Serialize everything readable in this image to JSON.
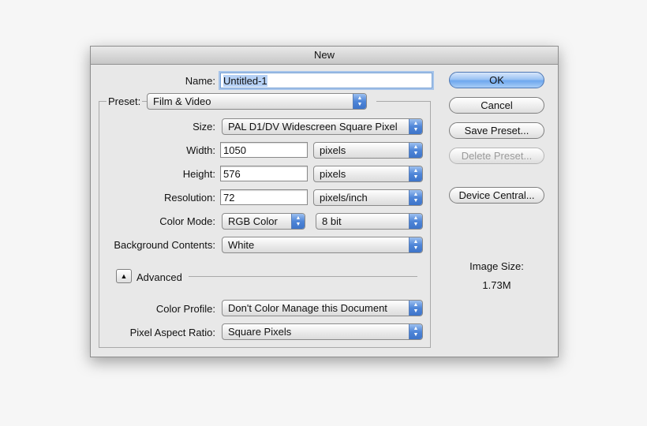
{
  "dialog": {
    "title": "New",
    "name_label": "Name:",
    "name_value": "Untitled-1",
    "preset_label": "Preset:",
    "preset_value": "Film & Video",
    "size_label": "Size:",
    "size_value": "PAL D1/DV Widescreen Square Pixel",
    "width_label": "Width:",
    "width_value": "1050",
    "width_unit": "pixels",
    "height_label": "Height:",
    "height_value": "576",
    "height_unit": "pixels",
    "resolution_label": "Resolution:",
    "resolution_value": "72",
    "resolution_unit": "pixels/inch",
    "color_mode_label": "Color Mode:",
    "color_mode_value": "RGB Color",
    "bit_depth_value": "8 bit",
    "background_label": "Background Contents:",
    "background_value": "White",
    "advanced_label": "Advanced",
    "color_profile_label": "Color Profile:",
    "color_profile_value": "Don't Color Manage this Document",
    "pixel_aspect_label": "Pixel Aspect Ratio:",
    "pixel_aspect_value": "Square Pixels"
  },
  "buttons": {
    "ok": "OK",
    "cancel": "Cancel",
    "save_preset": "Save Preset...",
    "delete_preset": "Delete Preset...",
    "device_central": "Device Central..."
  },
  "image_size": {
    "label": "Image Size:",
    "value": "1.73M"
  },
  "icons": {
    "popup_arrows": "up-down-arrows-icon",
    "disclosure": "triangle-up-icon"
  },
  "colors": {
    "accent": "#6ea7ee",
    "selection": "#b6d1f5"
  }
}
